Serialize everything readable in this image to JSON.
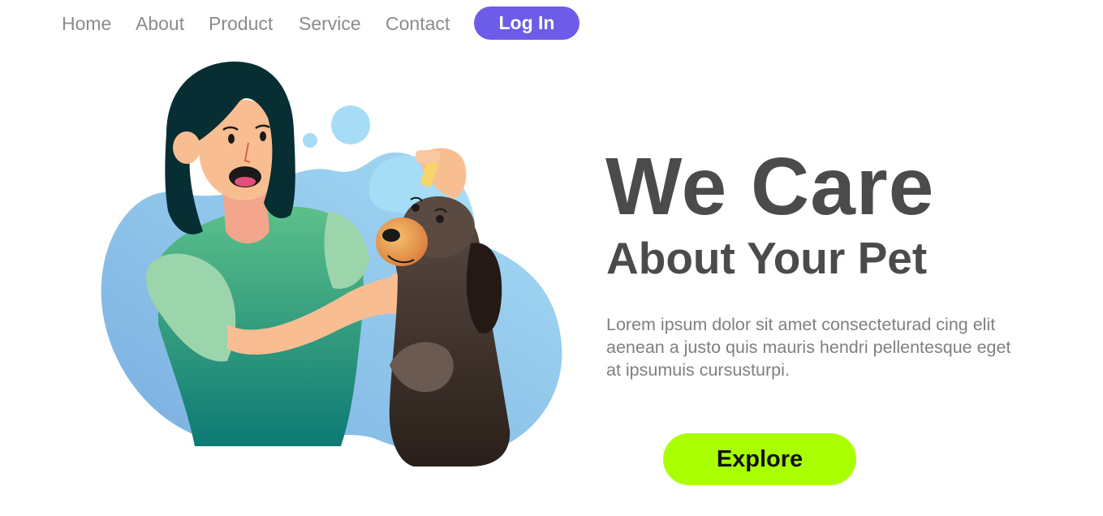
{
  "nav": {
    "items": [
      {
        "label": "Home"
      },
      {
        "label": "About"
      },
      {
        "label": "Product"
      },
      {
        "label": "Service"
      },
      {
        "label": "Contact"
      }
    ],
    "login_label": "Log In"
  },
  "hero": {
    "headline": "We Care",
    "subheadline": "About Your Pet",
    "description": "Lorem ipsum dolor sit amet consecteturad cing elit aenean a justo quis mauris hendri pellentesque eget at ipsumuis cursusturpi.",
    "cta_label": "Explore"
  },
  "colors": {
    "accent_login": "#6c5ce7",
    "accent_cta": "#aaff00",
    "heading_text": "#4b4b4b",
    "nav_text": "#8c8c8c",
    "body_text": "#808080"
  },
  "illustration": {
    "subject": "woman-giving-dog-eye-drops-illustration"
  }
}
